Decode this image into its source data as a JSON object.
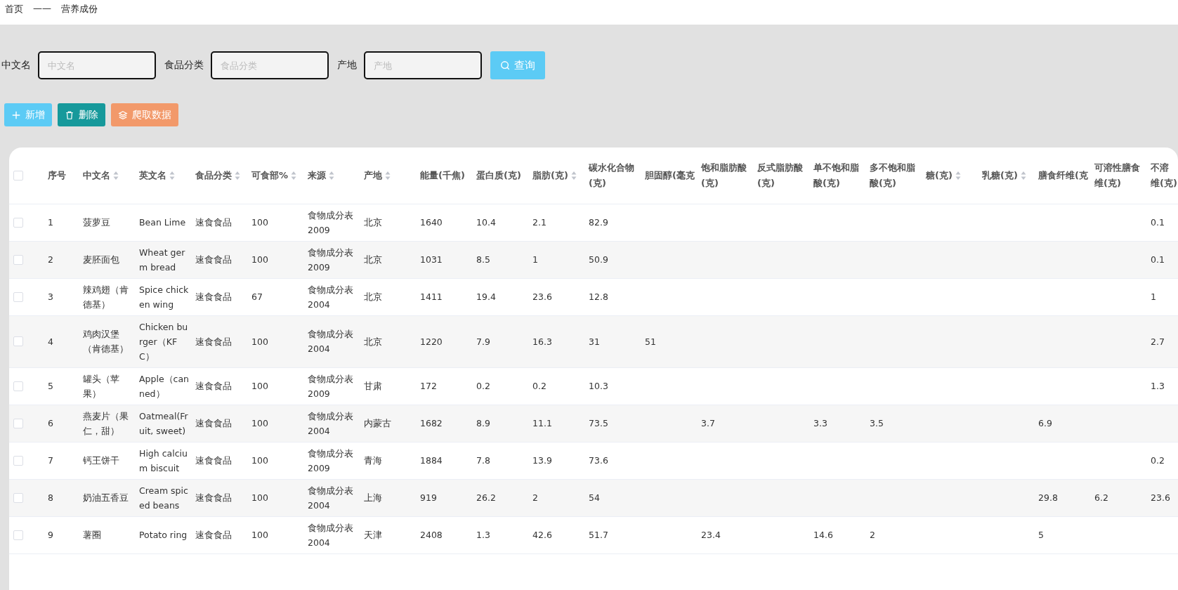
{
  "breadcrumb": [
    "首页",
    "——",
    "营养成份"
  ],
  "search": {
    "fields": [
      {
        "label": "中文名",
        "placeholder": "中文名"
      },
      {
        "label": "食品分类",
        "placeholder": "食品分类"
      },
      {
        "label": "产地",
        "placeholder": "产地"
      }
    ],
    "button": "查询"
  },
  "actions": [
    {
      "kind": "add",
      "label": "新增"
    },
    {
      "kind": "delete",
      "label": "删除"
    },
    {
      "kind": "crawl",
      "label": "爬取数据"
    }
  ],
  "table": {
    "all_checked": false,
    "columns": [
      {
        "lines": [
          "序号"
        ],
        "sortable": false
      },
      {
        "lines": [
          "中文名"
        ],
        "sortable": true
      },
      {
        "lines": [
          "英文名"
        ],
        "sortable": true
      },
      {
        "lines": [
          "食品分类"
        ],
        "sortable": true
      },
      {
        "lines": [
          "可食部%"
        ],
        "sortable": true
      },
      {
        "lines": [
          "来源"
        ],
        "sortable": true
      },
      {
        "lines": [
          "产地"
        ],
        "sortable": true
      },
      {
        "lines": [
          "能量(千焦)"
        ],
        "sortable": false
      },
      {
        "lines": [
          "蛋白质(克)"
        ],
        "sortable": false
      },
      {
        "lines": [
          "脂肪(克)"
        ],
        "sortable": true
      },
      {
        "lines": [
          "碳水化合物",
          "(克)"
        ],
        "sortable": false
      },
      {
        "lines": [
          "胆固醇(毫克"
        ],
        "sortable": false
      },
      {
        "lines": [
          "饱和脂肪酸",
          "(克)"
        ],
        "sortable": false
      },
      {
        "lines": [
          "反式脂肪酸",
          "(克)"
        ],
        "sortable": false
      },
      {
        "lines": [
          "单不饱和脂",
          "酸(克)"
        ],
        "sortable": false
      },
      {
        "lines": [
          "多不饱和脂",
          "酸(克)"
        ],
        "sortable": false
      },
      {
        "lines": [
          "糖(克)"
        ],
        "sortable": true
      },
      {
        "lines": [
          "乳糖(克)"
        ],
        "sortable": true
      },
      {
        "lines": [
          "膳食纤维(克"
        ],
        "sortable": false
      },
      {
        "lines": [
          "可溶性膳食",
          "维(克)"
        ],
        "sortable": false
      },
      {
        "lines": [
          "不溶",
          "维(克)"
        ],
        "sortable": false
      }
    ],
    "rows": [
      {
        "checked": false,
        "cells": [
          "1",
          "菠萝豆",
          "Bean Lime",
          "速食食品",
          "100",
          "食物成分表2009",
          "北京",
          "1640",
          "10.4",
          "2.1",
          "82.9",
          null,
          null,
          null,
          null,
          null,
          null,
          null,
          null,
          null,
          "0.1"
        ]
      },
      {
        "checked": false,
        "cells": [
          "2",
          "麦胚面包",
          "Wheat germ bread",
          "速食食品",
          "100",
          "食物成分表2009",
          "北京",
          "1031",
          "8.5",
          "1",
          "50.9",
          null,
          null,
          null,
          null,
          null,
          null,
          null,
          null,
          null,
          "0.1"
        ]
      },
      {
        "checked": false,
        "cells": [
          "3",
          "辣鸡翅（肯德基）",
          "Spice chicken wing",
          "速食食品",
          "67",
          "食物成分表2004",
          "北京",
          "1411",
          "19.4",
          "23.6",
          "12.8",
          null,
          null,
          null,
          null,
          null,
          null,
          null,
          null,
          null,
          "1"
        ]
      },
      {
        "checked": false,
        "cells": [
          "4",
          "鸡肉汉堡（肯德基）",
          "Chicken burger（KFC）",
          "速食食品",
          "100",
          "食物成分表2004",
          "北京",
          "1220",
          "7.9",
          "16.3",
          "31",
          "51",
          null,
          null,
          null,
          null,
          null,
          null,
          null,
          null,
          "2.7"
        ]
      },
      {
        "checked": false,
        "cells": [
          "5",
          "罐头（苹果）",
          "Apple（canned）",
          "速食食品",
          "100",
          "食物成分表2009",
          "甘肃",
          "172",
          "0.2",
          "0.2",
          "10.3",
          null,
          null,
          null,
          null,
          null,
          null,
          null,
          null,
          null,
          "1.3"
        ]
      },
      {
        "checked": false,
        "cells": [
          "6",
          "燕麦片（果仁，甜）",
          "Oatmeal(Fruit, sweet)",
          "速食食品",
          "100",
          "食物成分表2004",
          "内蒙古",
          "1682",
          "8.9",
          "11.1",
          "73.5",
          null,
          "3.7",
          null,
          "3.3",
          "3.5",
          null,
          null,
          "6.9",
          null,
          null
        ]
      },
      {
        "checked": false,
        "cells": [
          "7",
          "钙王饼干",
          "High calcium biscuit",
          "速食食品",
          "100",
          "食物成分表2009",
          "青海",
          "1884",
          "7.8",
          "13.9",
          "73.6",
          null,
          null,
          null,
          null,
          null,
          null,
          null,
          null,
          null,
          "0.2"
        ]
      },
      {
        "checked": false,
        "cells": [
          "8",
          "奶油五香豆",
          "Cream spiced beans",
          "速食食品",
          "100",
          "食物成分表2004",
          "上海",
          "919",
          "26.2",
          "2",
          "54",
          null,
          null,
          null,
          null,
          null,
          null,
          null,
          "29.8",
          "6.2",
          "23.6"
        ]
      },
      {
        "checked": false,
        "cells": [
          "9",
          "薯圈",
          "Potato ring",
          "速食食品",
          "100",
          "食物成分表2004",
          "天津",
          "2408",
          "1.3",
          "42.6",
          "51.7",
          null,
          "23.4",
          null,
          "14.6",
          "2",
          null,
          null,
          "5",
          null,
          null
        ]
      }
    ]
  }
}
